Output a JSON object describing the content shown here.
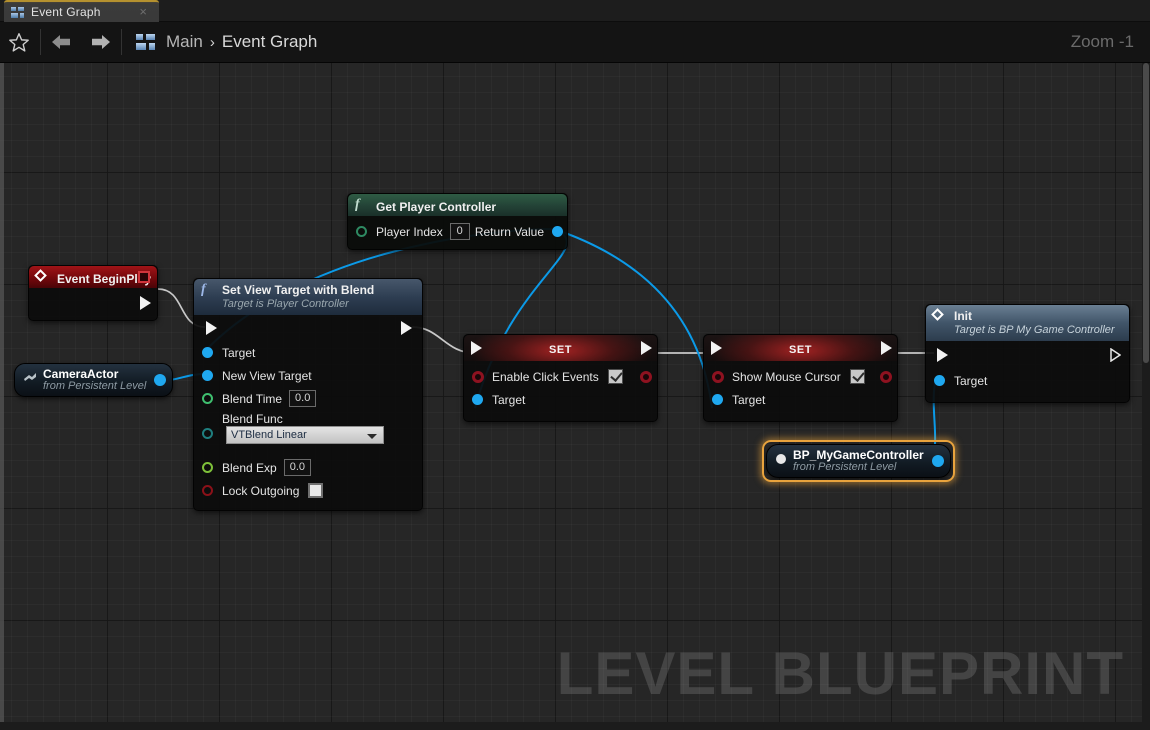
{
  "window": {
    "tab": {
      "label": "Event Graph",
      "icon": "graph-icon",
      "close": "×"
    },
    "zoom_label": "Zoom -1",
    "watermark": "LEVEL BLUEPRINT"
  },
  "toolbar": {
    "favorite_icon": "star-icon",
    "back_icon": "arrow-left-icon",
    "forward_icon": "arrow-right-icon",
    "breadcrumb_icon": "graph-icon",
    "breadcrumb": {
      "root": "Main",
      "separator": "›",
      "current": "Event Graph"
    }
  },
  "graph": {
    "nodes": [
      {
        "id": "event-begin-play",
        "title": "Event BeginPlay",
        "type": "event",
        "icon": "event-diamond-icon",
        "has_delegate_box": true
      },
      {
        "id": "camera-actor",
        "title": "CameraActor",
        "subtitle": "from Persistent Level",
        "type": "variable-ref",
        "icon": "actor-icon"
      },
      {
        "id": "set-view-target-with-blend",
        "title": "Set View Target with Blend",
        "subtitle": "Target is Player Controller",
        "type": "function",
        "icon": "function-icon",
        "inputs": [
          {
            "label": "Target",
            "pin": "object"
          },
          {
            "label": "New View Target",
            "pin": "object"
          },
          {
            "label": "Blend Time",
            "pin": "float",
            "value": "0.0"
          },
          {
            "label": "Blend Func",
            "pin": "enum",
            "value": "VTBlend Linear",
            "control": "dropdown"
          },
          {
            "label": "Blend Exp",
            "pin": "float",
            "value": "0.0"
          },
          {
            "label": "Lock Outgoing",
            "pin": "bool",
            "control": "checkbox",
            "checked": false
          }
        ]
      },
      {
        "id": "get-player-controller",
        "title": "Get Player Controller",
        "type": "function-pure",
        "icon": "function-icon",
        "inputs": [
          {
            "label": "Player Index",
            "pin": "int",
            "value": "0"
          }
        ],
        "outputs": [
          {
            "label": "Return Value",
            "pin": "object"
          }
        ]
      },
      {
        "id": "set-enable-click-events",
        "title": "SET",
        "type": "setter",
        "inputs": [
          {
            "label": "Enable Click Events",
            "pin": "bool",
            "control": "checkbox",
            "checked": true
          },
          {
            "label": "Target",
            "pin": "object"
          }
        ]
      },
      {
        "id": "set-show-mouse-cursor",
        "title": "SET",
        "type": "setter",
        "inputs": [
          {
            "label": "Show Mouse Cursor",
            "pin": "bool",
            "control": "checkbox",
            "checked": true
          },
          {
            "label": "Target",
            "pin": "object"
          }
        ]
      },
      {
        "id": "init",
        "title": "Init",
        "subtitle": "Target is BP My Game Controller",
        "type": "event-call",
        "icon": "event-diamond-icon",
        "inputs": [
          {
            "label": "Target",
            "pin": "object"
          }
        ]
      },
      {
        "id": "bp-my-game-controller",
        "title": "BP_MyGameController",
        "subtitle": "from Persistent Level",
        "type": "variable-ref",
        "icon": "object-icon",
        "selected": true
      }
    ],
    "colors": {
      "exec_wire": "#c9c9c9",
      "object_wire": "#0b9ae8",
      "selection": "#e8a33d",
      "background": "#262626",
      "event_header": "#8c1114",
      "function_header": "#2e3e52",
      "set_header": "#a82323"
    }
  }
}
